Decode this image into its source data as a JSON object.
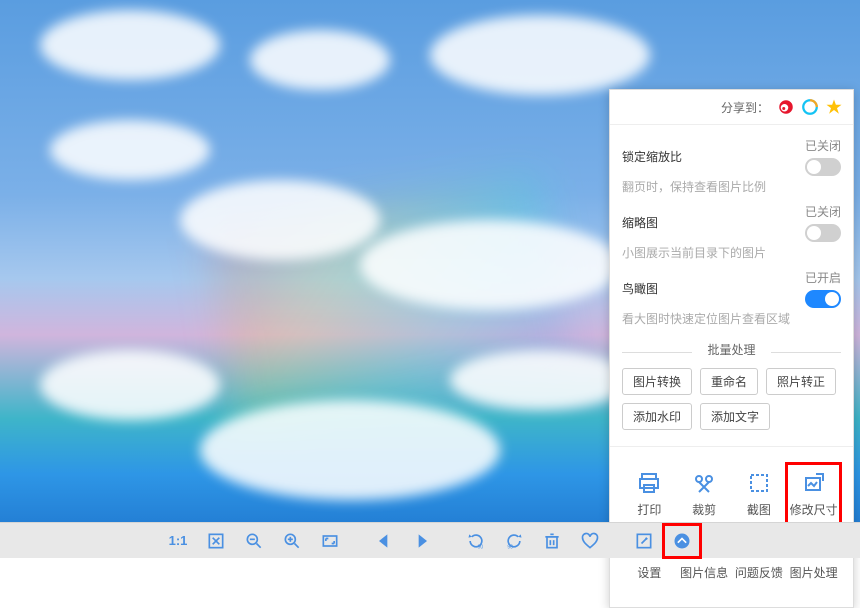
{
  "share": {
    "label": "分享到："
  },
  "settings": {
    "lock_ratio": {
      "title": "锁定缩放比",
      "desc": "翻页时，保持查看图片比例",
      "status": "已关闭"
    },
    "thumbnail": {
      "title": "缩略图",
      "desc": "小图展示当前目录下的图片",
      "status": "已关闭"
    },
    "birdview": {
      "title": "鸟瞰图",
      "desc": "看大图时快速定位图片查看区域",
      "status": "已开启"
    }
  },
  "batch": {
    "title": "批量处理",
    "chips": [
      "图片转换",
      "重命名",
      "照片转正",
      "添加水印",
      "添加文字"
    ]
  },
  "tools": {
    "print": "打印",
    "crop": "裁剪",
    "screenshot": "截图",
    "resize": "修改尺寸",
    "settings": "设置",
    "info": "图片信息",
    "feedback": "问题反馈",
    "process": "图片处理"
  },
  "bottombar": {
    "ratio_label": "1:1"
  }
}
